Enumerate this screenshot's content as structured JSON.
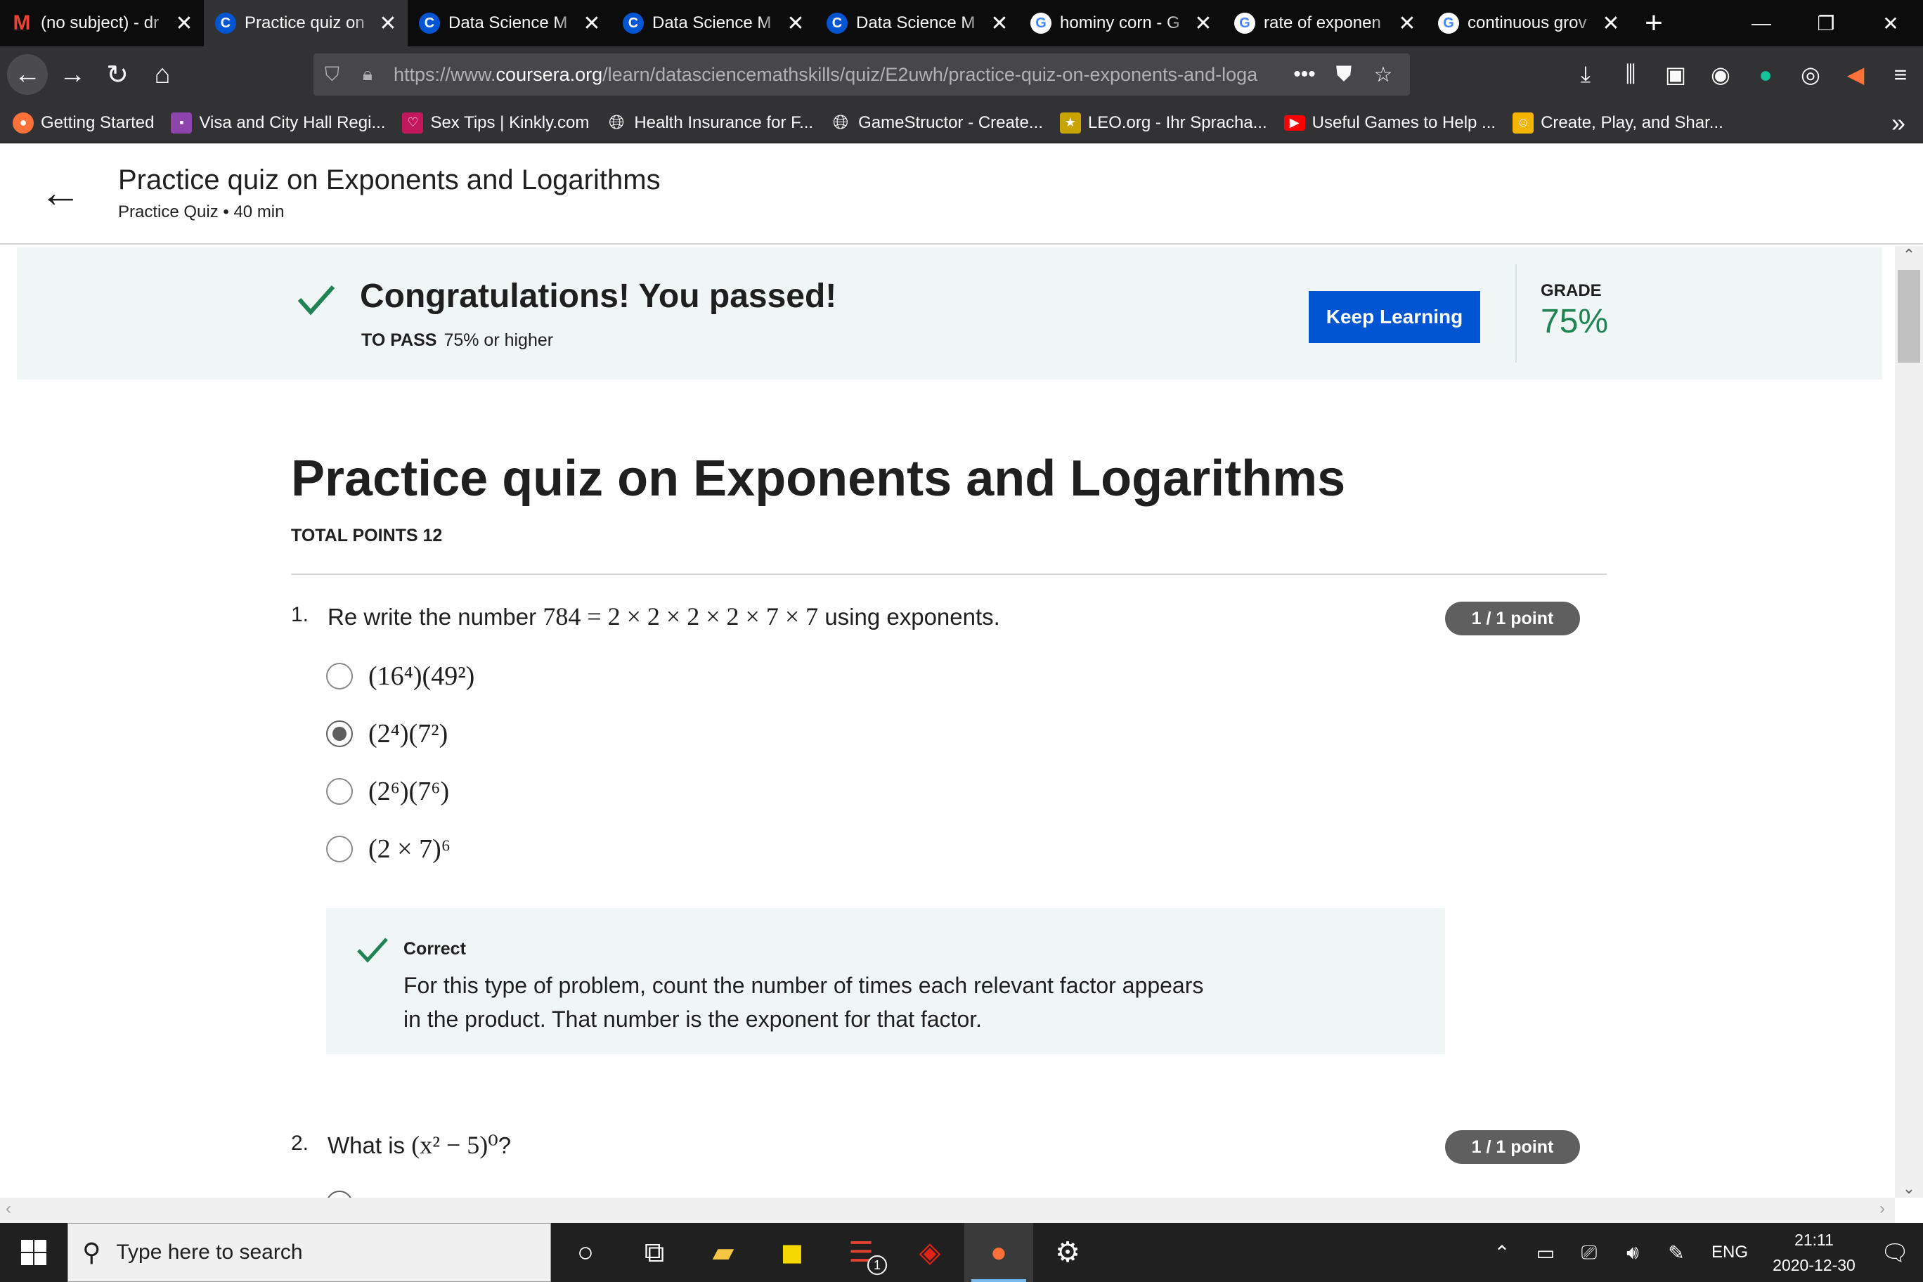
{
  "browser": {
    "tabs": [
      {
        "title": "(no subject) - dr",
        "favicon": "gmail-icon",
        "active": false
      },
      {
        "title": "Practice quiz on",
        "favicon": "coursera-icon",
        "active": true
      },
      {
        "title": "Data Science M",
        "favicon": "coursera-icon",
        "active": false
      },
      {
        "title": "Data Science M",
        "favicon": "coursera-icon",
        "active": false
      },
      {
        "title": "Data Science M",
        "favicon": "coursera-icon",
        "active": false
      },
      {
        "title": "hominy corn - G",
        "favicon": "google-icon",
        "active": false
      },
      {
        "title": "rate of exponen",
        "favicon": "google-icon",
        "active": false
      },
      {
        "title": "continuous grov",
        "favicon": "google-icon",
        "active": false
      }
    ],
    "url_prefix": "https://www.",
    "url_domain": "coursera.org",
    "url_path": "/learn/datasciencemathskills/quiz/E2uwh/practice-quiz-on-exponents-and-loga",
    "bookmarks": [
      {
        "label": "Getting Started",
        "icon": "firefox-icon",
        "color": "#ff7139"
      },
      {
        "label": "Visa and City Hall Regi...",
        "icon": "site-icon",
        "color": "#8e44ad"
      },
      {
        "label": "Sex Tips | Kinkly.com",
        "icon": "site-icon",
        "color": "#c2185b"
      },
      {
        "label": "Health Insurance for F...",
        "icon": "globe-icon",
        "color": "#323234"
      },
      {
        "label": "GameStructor - Create...",
        "icon": "globe-icon",
        "color": "#323234"
      },
      {
        "label": "LEO.org - Ihr Spracha...",
        "icon": "leo-icon",
        "color": "#c8a400"
      },
      {
        "label": "Useful Games to Help ...",
        "icon": "youtube-icon",
        "color": "#ff0000"
      },
      {
        "label": "Create, Play, and Shar...",
        "icon": "site-icon",
        "color": "#f5b400"
      }
    ]
  },
  "header": {
    "title": "Practice quiz on Exponents and Logarithms",
    "subtitle": "Practice Quiz • 40 min"
  },
  "banner": {
    "message": "Congratulations! You passed!",
    "to_pass_label": "TO PASS",
    "to_pass_value": "75% or higher",
    "button_label": "Keep Learning",
    "grade_label": "GRADE",
    "grade_value": "75%",
    "accent_color": "#1f8354"
  },
  "quiz": {
    "title": "Practice quiz on Exponents and Logarithms",
    "total_points": "TOTAL POINTS 12",
    "questions": [
      {
        "number": "1.",
        "prefix": "Re write the number",
        "math": "784 = 2 × 2 × 2 × 2 × 7 × 7",
        "suffix": "using exponents.",
        "points": "1 / 1 point",
        "options": [
          "(16⁴)(49²)",
          "(2⁴)(7²)",
          "(2⁶)(7⁶)",
          "(2 × 7)⁶"
        ],
        "selected_index": 1,
        "feedback_label": "Correct",
        "feedback_text": "For this type of problem, count the number of times each relevant factor appears in the product. That number is the exponent for that factor."
      },
      {
        "number": "2.",
        "prefix": "What is",
        "math": "(x² − 5)⁰",
        "suffix": "?",
        "points": "1 / 1 point"
      }
    ]
  },
  "taskbar": {
    "search_placeholder": "Type here to search",
    "language": "ENG",
    "time": "21:11",
    "date": "2020-12-30",
    "todoist_badge": "1"
  }
}
